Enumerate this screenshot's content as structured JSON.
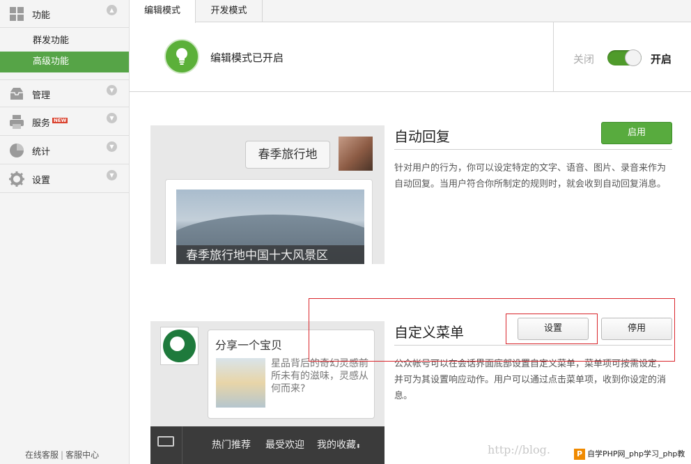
{
  "sidebar": {
    "sections": [
      {
        "label": "功能",
        "icon": "grid-icon",
        "expanded": true,
        "items": [
          {
            "label": "群发功能",
            "active": false
          },
          {
            "label": "高级功能",
            "active": true
          }
        ]
      },
      {
        "label": "管理",
        "icon": "inbox-icon"
      },
      {
        "label": "服务",
        "icon": "printer-icon",
        "badge": "NEW"
      },
      {
        "label": "统计",
        "icon": "pie-chart-icon"
      },
      {
        "label": "设置",
        "icon": "gear-icon"
      }
    ],
    "footer": {
      "online_service": "在线客服",
      "separator": "|",
      "service_center": "客服中心"
    }
  },
  "tabs": [
    {
      "label": "编辑模式",
      "active": true
    },
    {
      "label": "开发模式",
      "active": false
    }
  ],
  "mode": {
    "status_text": "编辑模式已开启",
    "switch_off_label": "关闭",
    "switch_on_label": "开启",
    "enabled": true,
    "accent": "#4f9b2b"
  },
  "auto_reply": {
    "title": "自动回复",
    "button": "启用",
    "description": "针对用户的行为，你可以设定特定的文字、语音、图片、录音来作为自动回复。当用户符合你所制定的规则时，就会收到自动回复消息。",
    "preview": {
      "bubble_text": "春季旅行地",
      "news_caption": "春季旅行地中国十大风景区"
    }
  },
  "custom_menu": {
    "title": "自定义菜单",
    "settings_button": "设置",
    "disable_button": "停用",
    "description": "公众帐号可以在会话界面底部设置自定义菜单，菜单项可按需设定，并可为其设置响应动作。用户可以通过点击菜单项，收到你设定的消息。",
    "preview": {
      "share_title": "分享一个宝贝",
      "share_desc": "星品背后的奇幻灵感前所未有的滋味，灵感从何而来?",
      "menu_items": [
        "热门推荐",
        "最受欢迎",
        "我的收藏"
      ]
    }
  },
  "watermark": "http://blog.",
  "php_tag": "自学PHP网_php学习_php教"
}
